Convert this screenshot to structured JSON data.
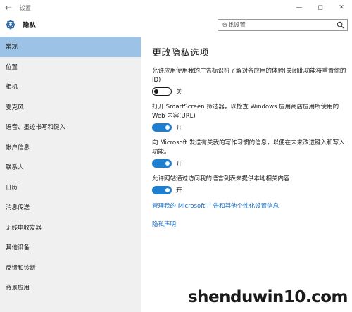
{
  "titlebar": {
    "app_title": "设置",
    "back_icon": "back-arrow-icon",
    "minimize_icon": "minimize-icon",
    "maximize_icon": "maximize-icon",
    "close_icon": "close-icon"
  },
  "header": {
    "icon": "gear-icon",
    "title": "隐私",
    "search_placeholder": "查找设置"
  },
  "sidebar": {
    "items": [
      {
        "label": "常规",
        "active": true
      },
      {
        "label": "位置"
      },
      {
        "label": "相机"
      },
      {
        "label": "麦克风"
      },
      {
        "label": "语音、墨迹书写和键入"
      },
      {
        "label": "帐户信息"
      },
      {
        "label": "联系人"
      },
      {
        "label": "日历"
      },
      {
        "label": "消息传送"
      },
      {
        "label": "无线电收发器"
      },
      {
        "label": "其他设备"
      },
      {
        "label": "反馈和诊断"
      },
      {
        "label": "背景应用"
      }
    ]
  },
  "main": {
    "title": "更改隐私选项",
    "settings": [
      {
        "desc": "允许应用使用我的广告标识符了解对各应用的体验(关闭此功能将重置你的 ID)",
        "state": "关",
        "on": false
      },
      {
        "desc": "打开 SmartScreen 筛选器，以检查 Windows 应用商店应用所使用的 Web 内容(URL)",
        "state": "开",
        "on": true
      },
      {
        "desc": "向 Microsoft 发送有关我的写作习惯的信息，以便在未来改进键入和写入功能。",
        "state": "开",
        "on": true
      },
      {
        "desc": "允许网站通过访问我的语言列表来提供本地相关内容",
        "state": "开",
        "on": true
      }
    ],
    "links": {
      "manage": "管理我的 Microsoft 广告和其他个性化设置信息",
      "privacy": "隐私声明"
    }
  },
  "watermark": "shenduwin10.com",
  "colors": {
    "accent": "#1e7fd0",
    "sidebar_active": "#9cc3e6",
    "sidebar_bg": "#f0f0f0",
    "link": "#1a6fc4"
  }
}
